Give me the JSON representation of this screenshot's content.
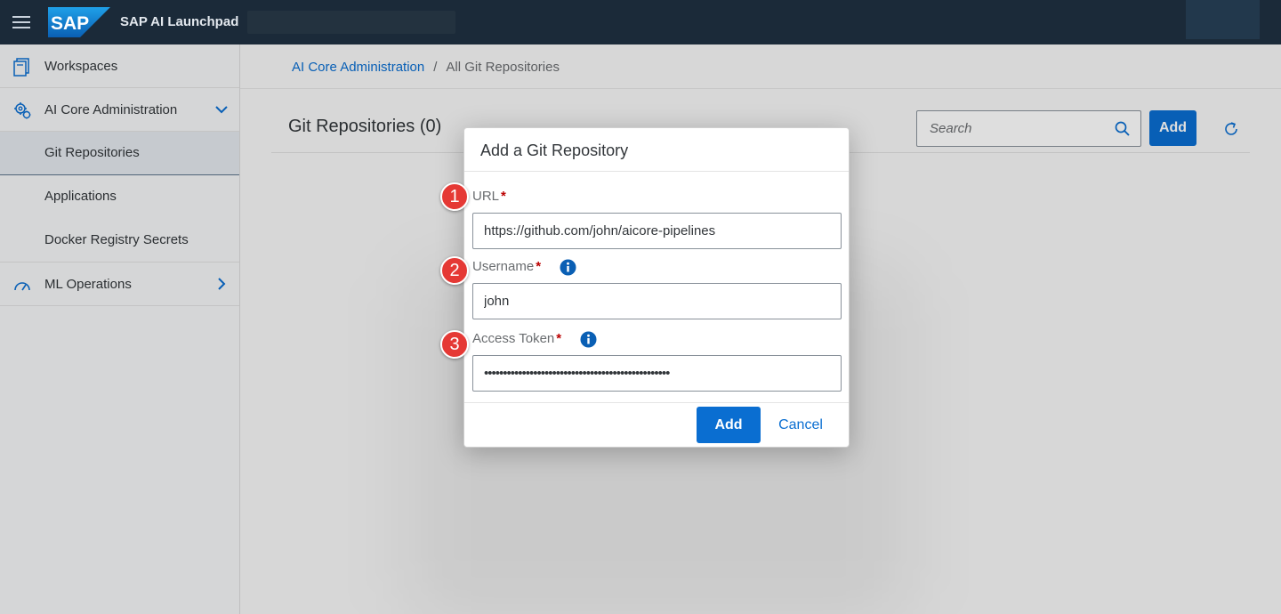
{
  "shell": {
    "app_title": "SAP AI Launchpad",
    "brand_color": "#1b2a39",
    "logo_icon": "sap-logo-icon"
  },
  "sidebar": {
    "items": [
      {
        "label": "Workspaces",
        "icon": "workspaces-icon"
      },
      {
        "label": "AI Core Administration",
        "icon": "admin-settings-icon",
        "expanded": true,
        "children": [
          {
            "label": "Git Repositories",
            "selected": true
          },
          {
            "label": "Applications"
          },
          {
            "label": "Docker Registry Secrets"
          }
        ]
      },
      {
        "label": "ML Operations",
        "icon": "gauge-icon",
        "expanded": false
      }
    ]
  },
  "main": {
    "breadcrumb": {
      "link": "AI Core Administration",
      "separator": "/",
      "current": "All Git Repositories"
    },
    "page_title": "Git Repositories (0)",
    "search_placeholder": "Search",
    "add_label": "Add",
    "accent_color": "#0a6ed1"
  },
  "dialog": {
    "title": "Add a Git Repository",
    "fields": [
      {
        "label": "URL",
        "required_mark": "*",
        "value": "https://github.com/john/aicore-pipelines",
        "step": "1",
        "has_info": false
      },
      {
        "label": "Username",
        "required_mark": "*",
        "value": "john",
        "step": "2",
        "has_info": true
      },
      {
        "label": "Access Token",
        "required_mark": "*",
        "value": "•••••••••••••••••••••••••••••••••••••••••••••••••",
        "step": "3",
        "has_info": true
      }
    ],
    "add_label": "Add",
    "cancel_label": "Cancel",
    "badge_color": "#e53935"
  }
}
